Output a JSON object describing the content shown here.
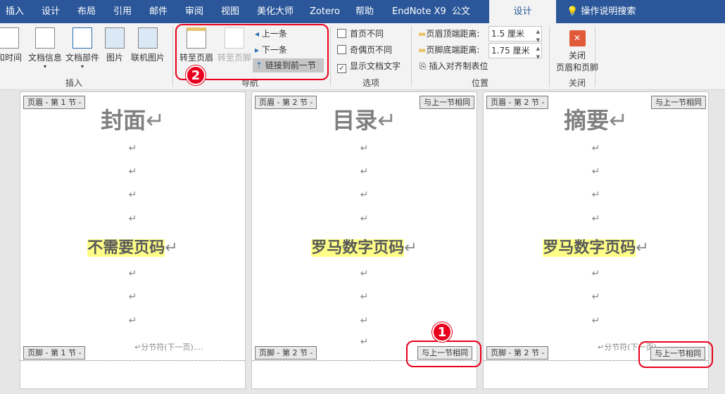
{
  "tabs": [
    "插入",
    "设计",
    "布局",
    "引用",
    "邮件",
    "审阅",
    "视图",
    "美化大师",
    "Zotero",
    "帮助",
    "EndNote X9",
    "公文",
    "设计"
  ],
  "tell_me": "操作说明搜索",
  "ribbon": {
    "insert_group": {
      "label": "插入",
      "buttons": [
        "和时间",
        "文档信息",
        "文档部件",
        "图片",
        "联机图片"
      ]
    },
    "nav_group": {
      "label": "导航",
      "goto_header": "转至页眉",
      "goto_footer": "转至页脚",
      "previous": "上一条",
      "next": "下一条",
      "link_previous": "链接到前一节"
    },
    "options_group": {
      "label": "选项",
      "different_first": "首页不同",
      "different_odd_even": "奇偶页不同",
      "show_doc_text": "显示文档文字",
      "different_first_checked": false,
      "different_odd_even_checked": false,
      "show_doc_text_checked": true
    },
    "position_group": {
      "label": "位置",
      "header_from_top_label": "页眉顶端距离:",
      "header_from_top": "1.5 厘米",
      "footer_from_bottom_label": "页脚底端距离:",
      "footer_from_bottom": "1.75 厘米",
      "insert_align_tab": "插入对齐制表位"
    },
    "close_group": {
      "label": "关闭",
      "close_line1": "关闭",
      "close_line2": "页眉和页脚"
    }
  },
  "annotations": {
    "badge1": "1",
    "badge2": "2"
  },
  "pages": [
    {
      "header_tag": "页眉 - 第 1 节 -",
      "title": "封面",
      "body": "不需要页码",
      "footer_tag": "页脚 - 第 1 节 -",
      "section_break": "分节符(下一页)"
    },
    {
      "header_tag": "页眉 - 第 2 节 -",
      "header_same": "与上一节相同",
      "title": "目录",
      "body": "罗马数字页码",
      "footer_tag": "页脚 - 第 2 节 -",
      "footer_same": "与上一节相同"
    },
    {
      "header_tag": "页眉 - 第 2 节 -",
      "header_same": "与上一节相同",
      "title": "摘要",
      "body": "罗马数字页码",
      "footer_tag": "页脚 - 第 2 节 -",
      "footer_same": "与上一节相同",
      "section_break": "分节符(下一页)"
    }
  ],
  "return_mark": "↵"
}
